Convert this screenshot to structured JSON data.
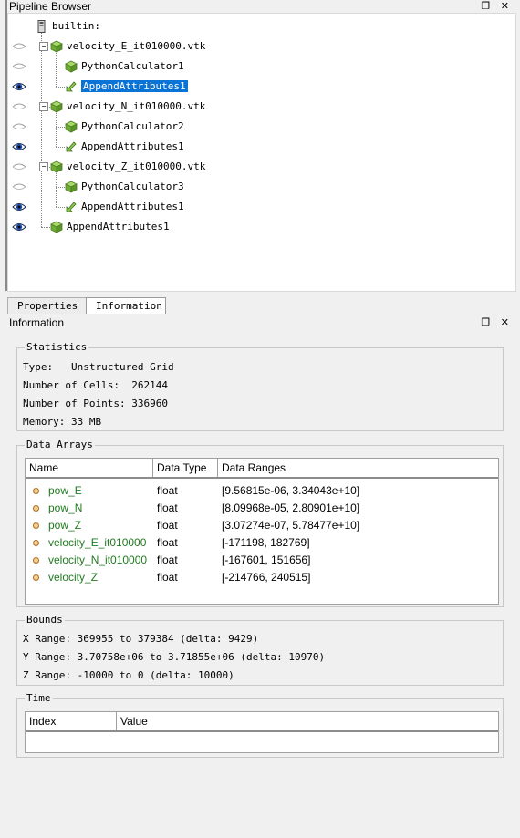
{
  "pipeline": {
    "title": "Pipeline Browser",
    "dock_float_icon": "❐",
    "dock_close_icon": "✕",
    "items": [
      {
        "label": "builtin:",
        "eye": "none",
        "icon": "server",
        "indent": 0
      },
      {
        "label": "velocity_E_it010000.vtk",
        "eye": "closed",
        "icon": "cube",
        "indent": 1,
        "expander": "minus"
      },
      {
        "label": "PythonCalculator1",
        "eye": "closed",
        "icon": "cube",
        "indent": 2
      },
      {
        "label": "AppendAttributes1",
        "eye": "open",
        "icon": "filter",
        "indent": 2,
        "selected": true
      },
      {
        "label": "velocity_N_it010000.vtk",
        "eye": "closed",
        "icon": "cube",
        "indent": 1,
        "expander": "minus"
      },
      {
        "label": "PythonCalculator2",
        "eye": "closed",
        "icon": "cube",
        "indent": 2
      },
      {
        "label": "AppendAttributes1",
        "eye": "open",
        "icon": "filter",
        "indent": 2
      },
      {
        "label": "velocity_Z_it010000.vtk",
        "eye": "closed",
        "icon": "cube",
        "indent": 1,
        "expander": "minus"
      },
      {
        "label": "PythonCalculator3",
        "eye": "closed",
        "icon": "cube",
        "indent": 2
      },
      {
        "label": "AppendAttributes1",
        "eye": "open",
        "icon": "filter",
        "indent": 2
      },
      {
        "label": "AppendAttributes1",
        "eye": "open",
        "icon": "cube",
        "indent": 1
      }
    ]
  },
  "tabs": [
    {
      "label": "Properties",
      "active": false
    },
    {
      "label": "Information",
      "active": true
    }
  ],
  "information": {
    "title": "Information",
    "statistics": {
      "title": "Statistics",
      "type_label": "Type:",
      "type_value": "Unstructured Grid",
      "cells_label": "Number of Cells:",
      "cells_value": "262144",
      "points_label": "Number of Points:",
      "points_value": "336960",
      "memory_label": "Memory:",
      "memory_value": "33 MB"
    },
    "data_arrays": {
      "title": "Data Arrays",
      "headers": [
        "Name",
        "Data Type",
        "Data Ranges"
      ],
      "rows": [
        {
          "name": "pow_E",
          "type": "float",
          "range": "[9.56815e-06, 3.34043e+10]"
        },
        {
          "name": "pow_N",
          "type": "float",
          "range": "[8.09968e-05, 2.80901e+10]"
        },
        {
          "name": "pow_Z",
          "type": "float",
          "range": "[3.07274e-07, 5.78477e+10]"
        },
        {
          "name": "velocity_E_it010000",
          "type": "float",
          "range": "[-171198, 182769]"
        },
        {
          "name": "velocity_N_it010000",
          "type": "float",
          "range": "[-167601, 151656]"
        },
        {
          "name": "velocity_Z",
          "type": "float",
          "range": "[-214766, 240515]"
        }
      ]
    },
    "bounds": {
      "title": "Bounds",
      "x": "X Range: 369955 to 379384 (delta: 9429)",
      "y": "Y Range: 3.70758e+06 to 3.71855e+06 (delta: 10970)",
      "z": "Z Range: -10000 to 0 (delta: 10000)"
    },
    "time": {
      "title": "Time",
      "headers": [
        "Index",
        "Value"
      ]
    }
  },
  "colors": {
    "selection": "#0a74d6",
    "array_name": "#217a21",
    "cube": "#7bbf3a"
  }
}
